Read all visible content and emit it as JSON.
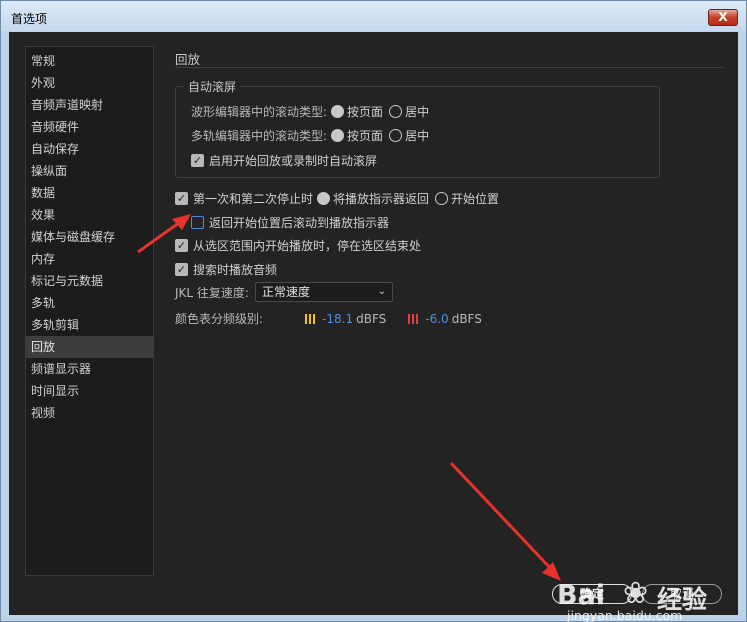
{
  "window": {
    "title": "首选项",
    "close_glyph": "X"
  },
  "sidebar": {
    "items": [
      {
        "label": "常规",
        "active": false
      },
      {
        "label": "外观",
        "active": false
      },
      {
        "label": "音频声道映射",
        "active": false
      },
      {
        "label": "音频硬件",
        "active": false
      },
      {
        "label": "自动保存",
        "active": false
      },
      {
        "label": "操纵面",
        "active": false
      },
      {
        "label": "数据",
        "active": false
      },
      {
        "label": "效果",
        "active": false
      },
      {
        "label": "媒体与磁盘缓存",
        "active": false
      },
      {
        "label": "内存",
        "active": false
      },
      {
        "label": "标记与元数据",
        "active": false
      },
      {
        "label": "多轨",
        "active": false
      },
      {
        "label": "多轨剪辑",
        "active": false
      },
      {
        "label": "回放",
        "active": true
      },
      {
        "label": "频谱显示器",
        "active": false
      },
      {
        "label": "时间显示",
        "active": false
      },
      {
        "label": "视频",
        "active": false
      }
    ]
  },
  "main": {
    "section_title": "回放",
    "auto_scroll": {
      "legend": "自动滚屏",
      "waveform_label": "波形编辑器中的滚动类型:",
      "multitrack_label": "多轨编辑器中的滚动类型:",
      "option_page": "按页面",
      "option_center": "居中",
      "waveform_selected": "按页面",
      "multitrack_selected": "按页面",
      "enable_label": "启用开始回放或录制时自动滚屏",
      "enable_checked": true
    },
    "stop_row": {
      "label": "第一次和第二次停止时",
      "checked": true,
      "option_return": "将播放指示器返回",
      "option_start": "开始位置",
      "selected": "将播放指示器返回"
    },
    "scroll_back": {
      "label": "返回开始位置后滚动到播放指示器",
      "checked": false
    },
    "stop_at_end": {
      "label": "从选区范围内开始播放时，停在选区结束处",
      "checked": true
    },
    "scrub_audio": {
      "label": "搜索时播放音频",
      "checked": true
    },
    "jkl": {
      "label": "JKL 往复速度:",
      "value": "正常速度"
    },
    "meter": {
      "label": "颜色表分频级别:",
      "yellow_value": "-18.1",
      "red_value": "-6.0",
      "unit": "dBFS",
      "yellow_color": "#f0c030",
      "red_color": "#e04040"
    }
  },
  "buttons": {
    "ok": "确定",
    "cancel": "取消"
  },
  "watermark": {
    "brand": "Bai",
    "brand2": "经验",
    "url": "jingyan.baidu.com"
  },
  "colors": {
    "accent": "#4a8fd6",
    "annotation_arrow": "#e8322c"
  }
}
